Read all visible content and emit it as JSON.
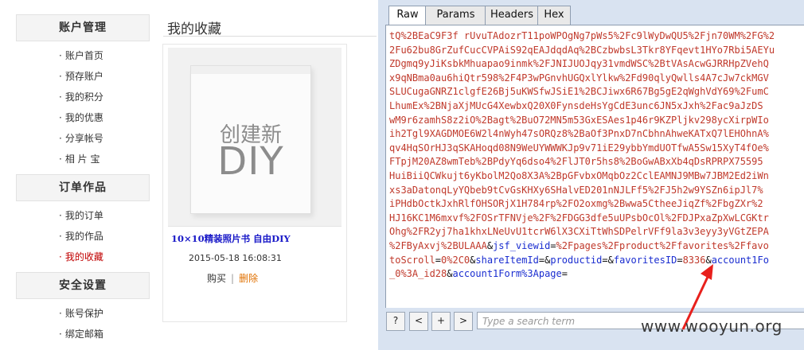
{
  "sidebar": {
    "sections": [
      {
        "title": "账户管理",
        "items": [
          "账户首页",
          "预存账户",
          "我的积分",
          "我的优惠",
          "分享帐号",
          "相 片 宝"
        ]
      },
      {
        "title": "订单作品",
        "items": [
          "我的订单",
          "我的作品",
          "我的收藏"
        ]
      },
      {
        "title": "安全设置",
        "items": [
          "账号保护",
          "绑定邮箱"
        ]
      }
    ],
    "bullet": "·"
  },
  "content": {
    "title": "我的收藏",
    "card": {
      "thumb_line1": "创建新",
      "thumb_line2": "DIY",
      "name": "10×10精装照片书 自由DIY",
      "date": "2015-05-18 16:08:31",
      "buy": "购买",
      "separator": "|",
      "delete": "删除"
    }
  },
  "panel": {
    "tabs": [
      "Raw",
      "Params",
      "Headers",
      "Hex"
    ],
    "raw_lines": [
      "tQ%2BEaC9F3f rUvuTAdozrT11poWPOgNg7pWs5%2Fc9lWyDwQU5%2Fjn70WM%2FG%2",
      "2Fu62bu8GrZufCucCVPAiS92qEAJdqdAq%2BCzbwbsL3Tkr8YFqevt1HYo7Rbi5AEYu",
      "ZDgmq9yJiKsbkMhuapao9inmk%2FJNIJUOJqy31vmdWSC%2BtVAsAcwGJRRHpZVehQ",
      "x9qNBma0au6hiQtr598%2F4P3wPGnvhUGQxlYlkw%2Fd90qlyQwlls4A7cJw7ckMGV",
      "SLUCugaGNRZ1clgfE26Bj5uKWSfwJSiE1%2BCJiwx6R67Bg5gE2qWghVdY69%2FumC",
      "LhumEx%2BNjaXjMUcG4XewbxQ20X0FynsdeHsYgCdE3unc6JN5xJxh%2Fac9aJzDS",
      "wM9r6zamhS8z2iO%2Bagt%2BuO72MN5m53GxESAes1p46r9KZPljkv298ycXirpWIo",
      "ih2Tgl9XAGDMOE6W2l4nWyh47sORQz8%2BaOf3PnxD7nCbhnAhweKATxQ7lEHOhnA%",
      "qv4HqSOrHJ3qSKAHoqd08N9WeUYWWWKJp9v71iE29ybbYmdUOTfwA5Sw15XyT4fOe%",
      "FTpjM20AZ8wmTeb%2BPdyYq6dso4%2FlJT0r5hs8%2BoGwABxXb4qDsRPRPX75595",
      "HuiBiiQCWkujt6yKbolM2Qo8X3A%2BpGFvbxOMqbOz2CclEAMNJ9MBw7JBM2Ed2iWn",
      "xs3aDatonqLyYQbeb9tCvGsKHXy6SHalvED201nNJLFf5%2FJ5h2w9YSZn6ipJl7%",
      "iPHdbOctkJxhRlfOHSORjX1H784rp%2FO2oxmg%2Bwwa5CtheeJiqZf%2FbgZXr%2",
      "HJ16KC1M6mxvf%2FOSrTFNVje%2F%2FDGG3dfe5uUPsbOcOl%2FDJPxaZpXwLCGKtr",
      "Ohg%2FR2yj7ha1khxLNeUvU1tcrW6lX3CXiTtWhSDPelrVFf9la3v3eyy3yVGtZEPA",
      "%2FByAxvj%2BULAAA&jsf_viewid=%2Fpages%2Fproduct%2Ffavorites%2Ffavo",
      "toScroll=0%2C0&shareItemId=&productid=&favoritesID=8336&account1Fo",
      "_0%3A_id28&account1Form%3Apage="
    ],
    "nav_buttons": [
      "?",
      "<",
      "+",
      ">"
    ],
    "search_placeholder": "Type a search term"
  },
  "watermark": "www.wooyun.org",
  "colors": {
    "value": "#c0392b",
    "key": "#1a2dd0",
    "arrow": "#e8201c",
    "active_item": "#c00000",
    "delete": "#e07000"
  }
}
